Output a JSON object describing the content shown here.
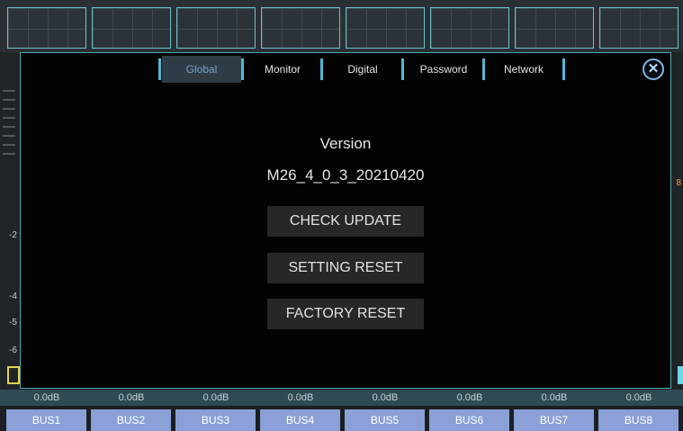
{
  "tabs": [
    {
      "label": "Global",
      "active": true
    },
    {
      "label": "Monitor",
      "active": false
    },
    {
      "label": "Digital",
      "active": false
    },
    {
      "label": "Password",
      "active": false
    },
    {
      "label": "Network",
      "active": false
    }
  ],
  "close": {
    "icon": "close-icon",
    "glyph": "✕"
  },
  "version": {
    "label": "Version",
    "value": "M26_4_0_3_20210420"
  },
  "buttons": {
    "check_update": "CHECK UPDATE",
    "setting_reset": "SETTING RESET",
    "factory_reset": "FACTORY RESET"
  },
  "background": {
    "scale_labels": [
      "-2",
      "-4",
      "-5",
      "-6"
    ],
    "right_label": "8",
    "gains": [
      "0.0dB",
      "0.0dB",
      "0.0dB",
      "0.0dB",
      "0.0dB",
      "0.0dB",
      "0.0dB",
      "0.0dB"
    ],
    "buses": [
      "BUS1",
      "BUS2",
      "BUS3",
      "BUS4",
      "BUS5",
      "BUS6",
      "BUS7",
      "BUS8"
    ]
  },
  "colors": {
    "accent_cyan": "#49a9b6",
    "tab_separator": "#4fb9d6",
    "bus_bg": "#8aa0d6",
    "active_tab_bg": "#2f3c48"
  }
}
